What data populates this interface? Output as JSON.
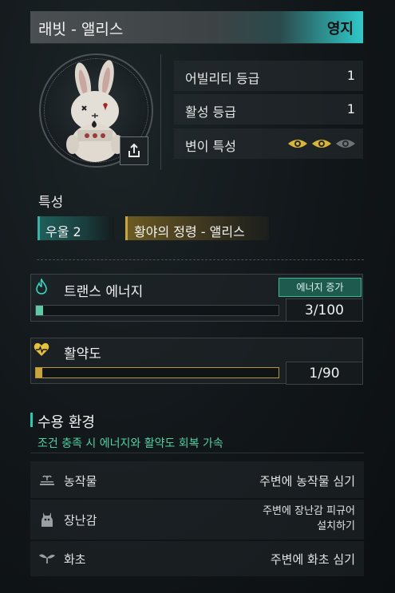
{
  "header": {
    "title": "래빗 - 앨리스",
    "tag": "영지"
  },
  "stats": [
    {
      "label": "어빌리티 등급",
      "value": "1"
    },
    {
      "label": "활성 등급",
      "value": "1"
    },
    {
      "label": "변이 특성",
      "value": ""
    }
  ],
  "mutation_eyes": {
    "total": 3,
    "active": 2,
    "active_color": "#d9b53a",
    "inactive_color": "#777c7f"
  },
  "traits": {
    "label": "특성",
    "items": [
      {
        "text": "우울 2"
      },
      {
        "text": "황야의 정령 - 앨리스"
      }
    ]
  },
  "trans_energy": {
    "label": "트랜스 에너지",
    "button": "에너지 증가",
    "value_text": "3/100",
    "fill_fraction": 0.03
  },
  "vitality": {
    "label": "활약도",
    "value_text": "1/90",
    "fill_fraction": 0.011
  },
  "environment": {
    "title": "수용 환경",
    "description": "조건 충족 시 에너지와 활약도 회복 가속",
    "rows": [
      {
        "name": "농작물",
        "action": "주변에 농작물 심기",
        "icon": "farm-icon"
      },
      {
        "name": "장난감",
        "action_line1": "주변에 장난감 피규어",
        "action_line2": "설치하기",
        "icon": "toy-icon"
      },
      {
        "name": "화초",
        "action": "주변에 화초 심기",
        "icon": "sprout-icon"
      }
    ]
  },
  "colors": {
    "accent_teal": "#2fc9c9",
    "env_green": "#4fd1a2",
    "gold": "#c9a53c"
  }
}
